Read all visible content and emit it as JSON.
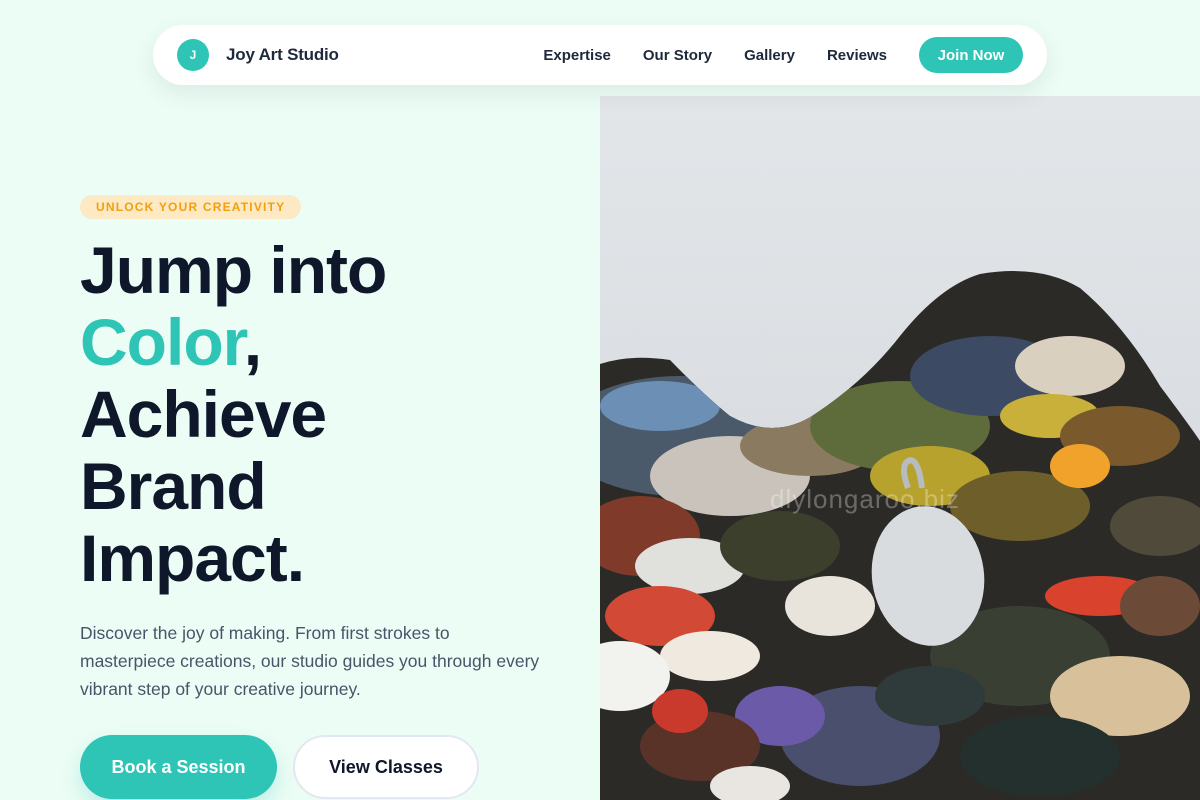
{
  "nav": {
    "brand_initial": "J",
    "brand_name": "Joy Art Studio",
    "links": [
      "Expertise",
      "Our Story",
      "Gallery",
      "Reviews"
    ],
    "cta": "Join Now"
  },
  "hero": {
    "eyebrow": "UNLOCK YOUR CREATIVITY",
    "headline": {
      "line1": "Jump into",
      "accent": "Color",
      "accent_suffix": ",",
      "line3": "Achieve",
      "line4": "Brand",
      "line5": "Impact."
    },
    "description": "Discover the joy of making. From first strokes to masterpiece creations, our studio guides you through every vibrant step of your creative journey.",
    "primary_button": "Book a Session",
    "secondary_button": "View Classes",
    "image_watermark": "dlylongaroo.biz"
  },
  "colors": {
    "accent": "#2ec4b6",
    "background": "#ecfdf5",
    "eyebrow_bg": "#fde9c4",
    "eyebrow_text": "#f59e0b",
    "heading": "#0f172a",
    "body_text": "#475569"
  },
  "icons": {
    "brand": "brand-initial-badge"
  }
}
